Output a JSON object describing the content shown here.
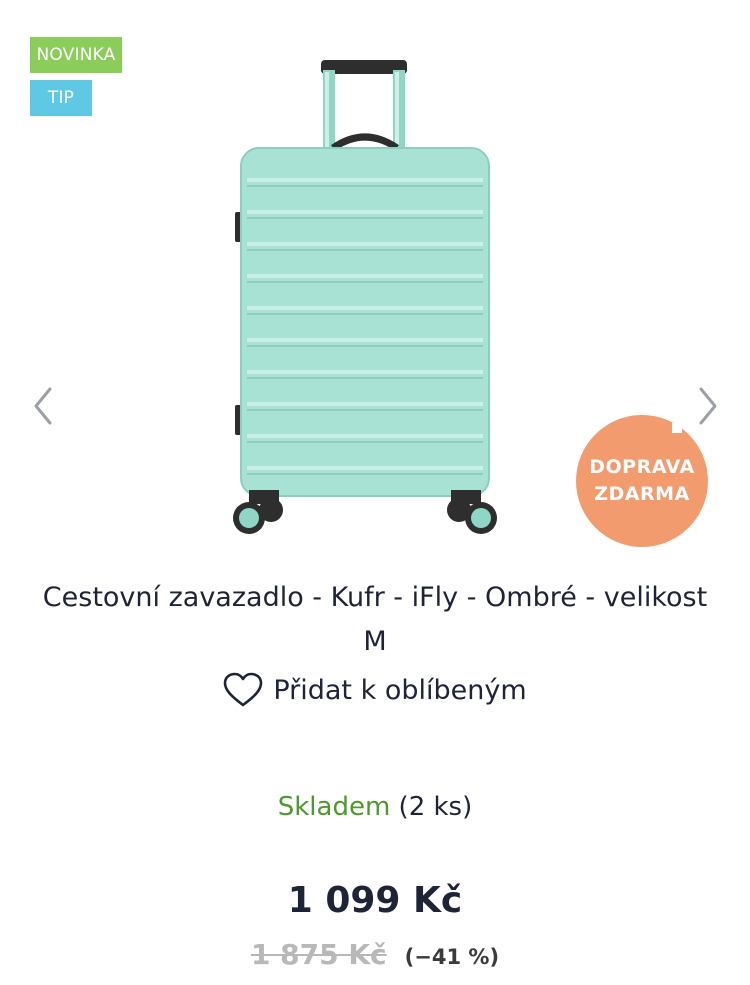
{
  "badges": {
    "new": "NOVINKA",
    "tip": "TIP"
  },
  "shipping_badge": {
    "line1": "DOPRAVA",
    "line2": "ZDARMA"
  },
  "product": {
    "title": "Cestovní zavazadlo - Kufr - iFly - Ombré - velikost M",
    "image_icon": "suitcase-image"
  },
  "favorite": {
    "label": "Přidat k oblíbeným",
    "icon": "heart-icon"
  },
  "stock": {
    "status": "Skladem",
    "count": "(2 ks)"
  },
  "pricing": {
    "price": "1 099 Kč",
    "old_price": "1 875 Kč",
    "discount": "(−41 %)"
  },
  "colors": {
    "new_badge": "#8ccc5b",
    "tip_badge": "#5fc9e5",
    "shipping": "#f29b6e",
    "in_stock": "#4c9a2a",
    "suitcase": "#a8e2d5"
  }
}
